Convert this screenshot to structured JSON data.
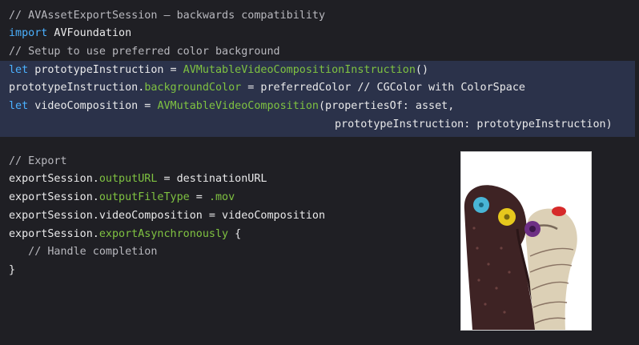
{
  "code": {
    "block1": {
      "line1_comment": "// AVAssetExportSession – backwards compatibility",
      "line2_kw": "import",
      "line2_rest": " AVFoundation",
      "line3_comment": "// Setup to use preferred color background",
      "line4_kw": "let",
      "line4_a": " prototypeInstruction = ",
      "line4_type": "AVMutableVideoCompositionInstruction",
      "line4_b": "()",
      "line5_a": "prototypeInstruction.",
      "line5_prop": "backgroundColor",
      "line5_b": " = preferredColor // CGColor with ColorSpace",
      "line6_kw": "let",
      "line6_a": " videoComposition = ",
      "line6_type": "AVMutableVideoComposition",
      "line6_b": "(propertiesOf: asset,",
      "line7": "prototypeInstruction: prototypeInstruction)"
    },
    "block2": {
      "line1_comment": "// Export",
      "line2_a": "exportSession.",
      "line2_prop": "outputURL",
      "line2_b": " = destinationURL",
      "line3_a": "exportSession.",
      "line3_prop": "outputFileType",
      "line3_b": " = ",
      "line3_val": ".mov",
      "line4": "exportSession.videoComposition = videoComposition",
      "line5_a": "exportSession.",
      "line5_prop": "exportAsynchronously",
      "line5_b": " {",
      "line6_comment": "   // Handle completion",
      "line7": "}"
    }
  },
  "image": {
    "subject": "sock-puppets-photo"
  },
  "colors": {
    "background": "#1f1f24",
    "highlight": "#2b324a",
    "keyword": "#4bb1ff",
    "type": "#7fc241",
    "text": "#e9e9ea",
    "comment": "#b8b8be"
  }
}
